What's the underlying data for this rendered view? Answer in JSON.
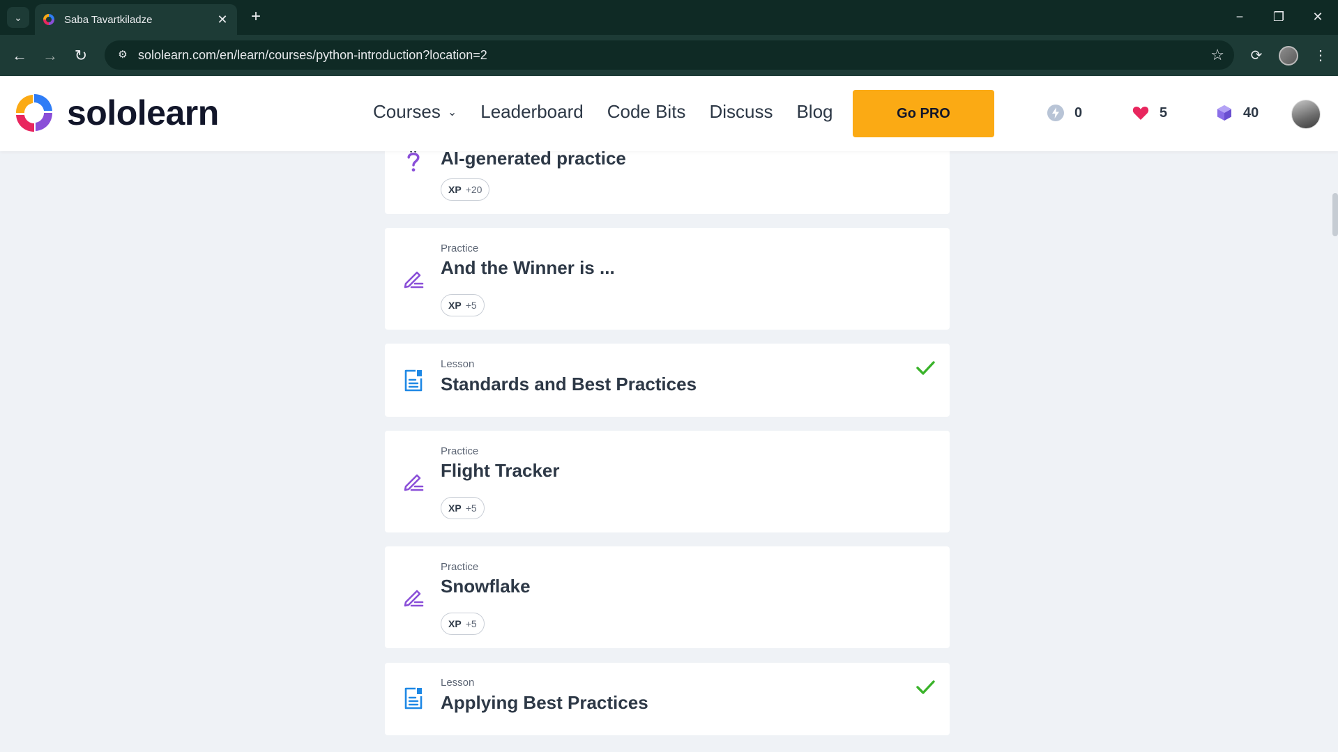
{
  "browser": {
    "tab_title": "Saba Tavartkiladze",
    "new_tab_label": "+",
    "url": "sololearn.com/en/learn/courses/python-introduction?location=2"
  },
  "header": {
    "logo_text": "sololearn",
    "nav": [
      {
        "label": "Courses"
      },
      {
        "label": "Leaderboard"
      },
      {
        "label": "Code Bits"
      },
      {
        "label": "Discuss"
      },
      {
        "label": "Blog"
      }
    ],
    "gopro_label": "Go PRO",
    "streak": "0",
    "hearts": "5",
    "gems": "40"
  },
  "cards": [
    {
      "type": "",
      "title": "AI-generated practice",
      "xp_label": "XP",
      "xp": "+20",
      "icon": "question-icon",
      "completed": false
    },
    {
      "type": "Practice",
      "title": "And the Winner is ...",
      "xp_label": "XP",
      "xp": "+5",
      "icon": "pencil-icon",
      "completed": false
    },
    {
      "type": "Lesson",
      "title": "Standards and Best Practices",
      "icon": "document-icon",
      "completed": true
    },
    {
      "type": "Practice",
      "title": "Flight Tracker",
      "xp_label": "XP",
      "xp": "+5",
      "icon": "pencil-icon",
      "completed": false
    },
    {
      "type": "Practice",
      "title": "Snowflake",
      "xp_label": "XP",
      "xp": "+5",
      "icon": "pencil-icon",
      "completed": false
    },
    {
      "type": "Lesson",
      "title": "Applying Best Practices",
      "icon": "document-icon",
      "completed": true
    }
  ],
  "colors": {
    "accent_purple": "#8a4fd8",
    "lesson_blue": "#1e88e5",
    "check_green": "#3ab32a",
    "gopro": "#fbaa14",
    "heart": "#e8265e"
  }
}
